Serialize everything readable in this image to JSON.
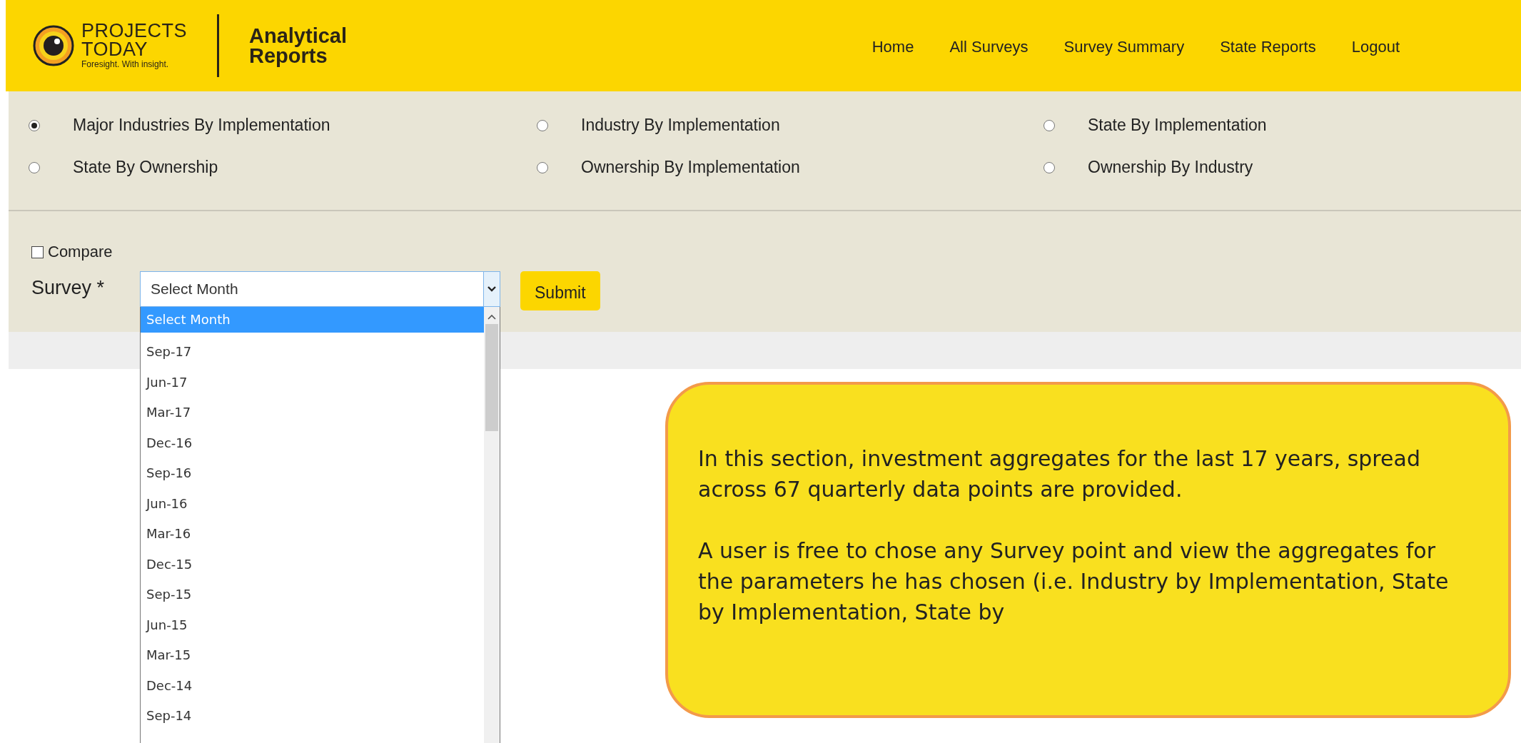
{
  "header": {
    "brand_lines": [
      "PROJECTS",
      "TODAY"
    ],
    "tagline": "Foresight. With insight.",
    "section_lines": [
      "Analytical",
      "Reports"
    ],
    "nav": [
      "Home",
      "All Surveys",
      "Survey Summary",
      "State Reports",
      "Logout"
    ]
  },
  "report_types": [
    {
      "label": "Major Industries By Implementation",
      "selected": true
    },
    {
      "label": "Industry By Implementation",
      "selected": false
    },
    {
      "label": "State By Implementation",
      "selected": false
    },
    {
      "label": "State By Ownership",
      "selected": false
    },
    {
      "label": "Ownership By Implementation",
      "selected": false
    },
    {
      "label": "Ownership By Industry",
      "selected": false
    }
  ],
  "compare": {
    "label": "Compare",
    "checked": false
  },
  "survey": {
    "label": "Survey *",
    "value": "Select Month",
    "expanded": true,
    "options": [
      {
        "label": "Select Month",
        "selected": true
      },
      {
        "label": "Sep-17",
        "selected": false
      },
      {
        "label": "Jun-17",
        "selected": false
      },
      {
        "label": "Mar-17",
        "selected": false
      },
      {
        "label": "Dec-16",
        "selected": false
      },
      {
        "label": "Sep-16",
        "selected": false
      },
      {
        "label": "Jun-16",
        "selected": false
      },
      {
        "label": "Mar-16",
        "selected": false
      },
      {
        "label": "Dec-15",
        "selected": false
      },
      {
        "label": "Sep-15",
        "selected": false
      },
      {
        "label": "Jun-15",
        "selected": false
      },
      {
        "label": "Mar-15",
        "selected": false
      },
      {
        "label": "Dec-14",
        "selected": false
      },
      {
        "label": "Sep-14",
        "selected": false
      }
    ]
  },
  "submit": "Submit",
  "info": [
    "In this section, investment aggregates for the last 17 years, spread across 67 quarterly data points are provided.",
    "A user is free to chose any Survey point and view the aggregates for the parameters he has chosen (i.e. Industry by Implementation, State by Implementation, State by"
  ]
}
